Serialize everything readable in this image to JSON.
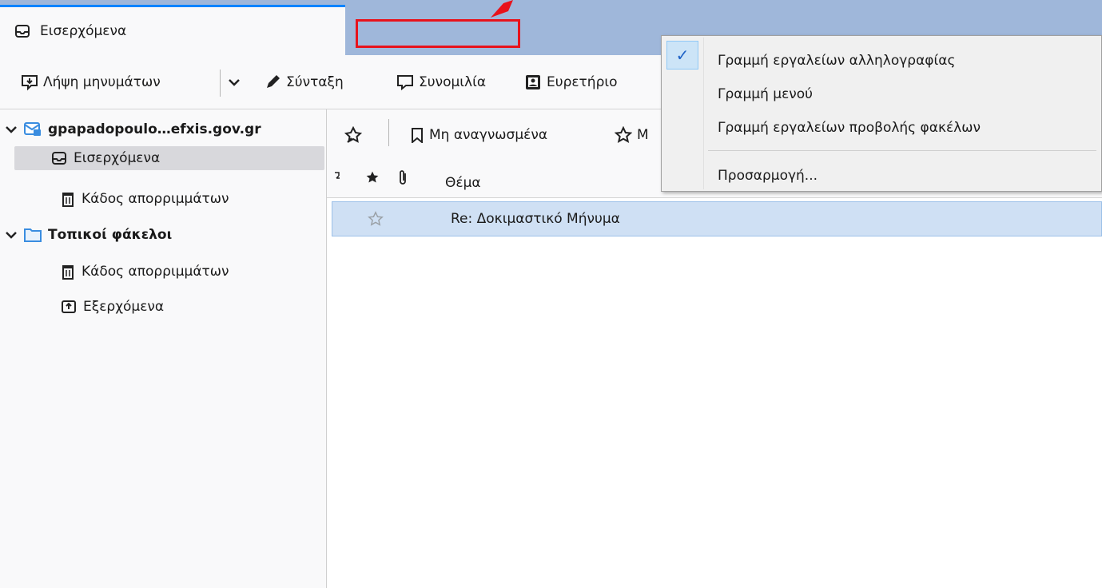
{
  "tab": {
    "title": "Εισερχόμενα"
  },
  "toolbar": {
    "get_messages": "Λήψη μηνυμάτων",
    "compose": "Σύνταξη",
    "chat": "Συνομιλία",
    "address_book": "Ευρετήριο"
  },
  "folders": {
    "account": "gpapadopoulo…efxis.gov.gr",
    "inbox": "Εισερχόμενα",
    "trash": "Κάδος απορριμμάτων",
    "local_folders": "Τοπικοί φάκελοι",
    "local_trash": "Κάδος απορριμμάτων",
    "outbox": "Εξερχόμενα"
  },
  "filter_bar": {
    "unread": "Μη αναγνωσμένα",
    "starred_partial": "Μ"
  },
  "columns": {
    "subject": "Θέμα"
  },
  "messages": [
    {
      "subject": "Re: Δοκιμαστικό Μήνυμα",
      "starred": false
    }
  ],
  "context_menu": {
    "items": [
      {
        "label": "Γραμμή εργαλείων αλληλογραφίας",
        "checked": true
      },
      {
        "label": "Γραμμή μενού",
        "checked": false
      },
      {
        "label": "Γραμμή εργαλείων προβολής φακέλων",
        "checked": false
      },
      {
        "label": "Προσαρμογή...",
        "checked": false
      }
    ]
  },
  "colors": {
    "tab_strip": "#9fb7da",
    "accent": "#0a84ff",
    "annotation_red": "#e8121b",
    "selection": "#cfe0f4"
  }
}
